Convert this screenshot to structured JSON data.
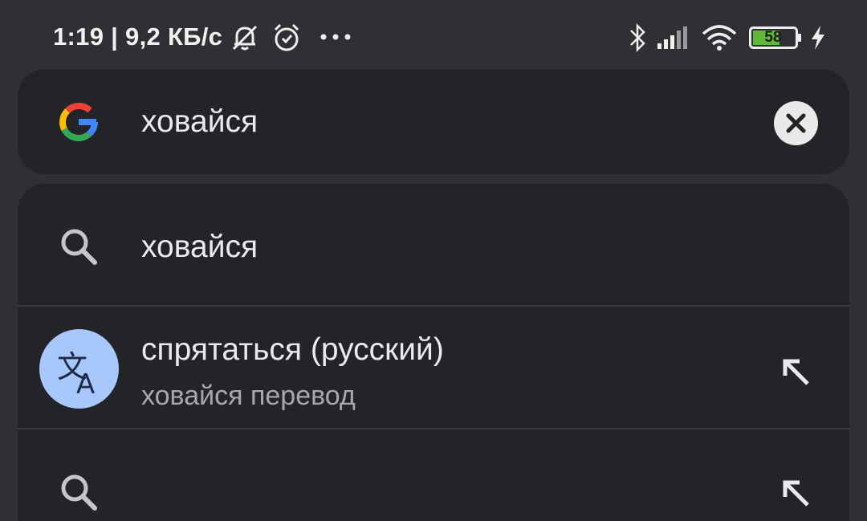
{
  "status_bar": {
    "time_speed": "1:19 | 9,2 КБ/с",
    "battery_level": "58",
    "icons": [
      "mute-bell-icon",
      "alarm-icon",
      "more-dots-icon",
      "bluetooth-icon",
      "signal-icon",
      "wifi-icon",
      "battery-icon",
      "charging-bolt-icon"
    ]
  },
  "search": {
    "query": "ховайся",
    "logo": "google-logo",
    "clear_icon": "clear-icon"
  },
  "suggestions": [
    {
      "icon": "search-icon",
      "text": "ховайся"
    },
    {
      "icon": "translate-icon",
      "text": "спрятаться (русский)",
      "subtext": "ховайся перевод",
      "action_icon": "fill-arrow-icon"
    },
    {
      "icon": "search-icon",
      "text": "",
      "action_icon": "fill-arrow-icon"
    }
  ],
  "colors": {
    "background": "#2f3033",
    "surface": "#232427",
    "translate_avatar": "#a8c7fa",
    "battery_fill": "#5fb83a"
  }
}
